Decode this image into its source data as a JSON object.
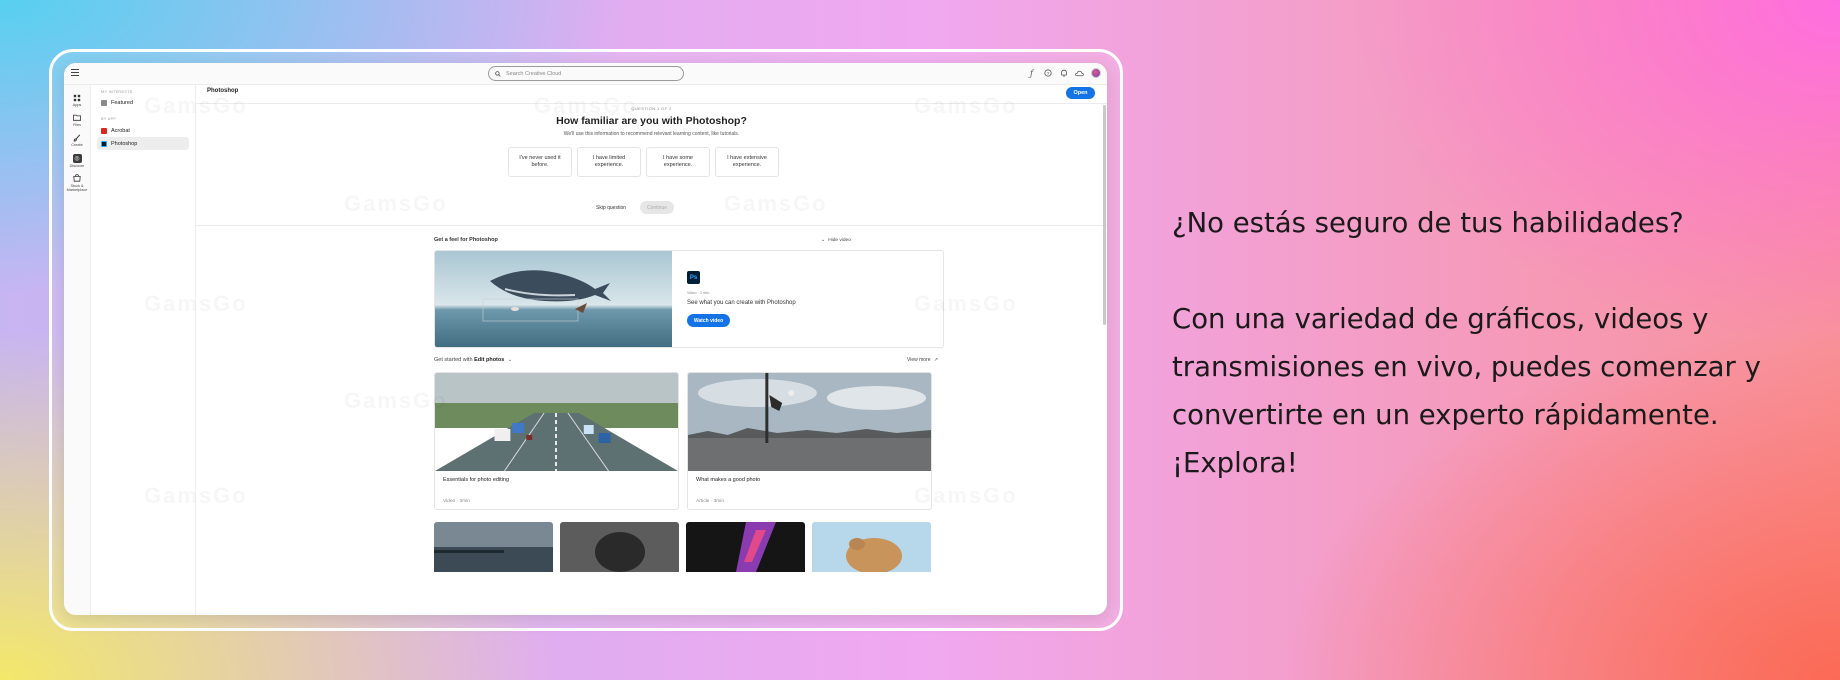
{
  "search": {
    "placeholder": "Search Creative Cloud"
  },
  "rail": [
    {
      "label": "Apps"
    },
    {
      "label": "Files"
    },
    {
      "label": "Create"
    },
    {
      "label": "Discover"
    },
    {
      "label": "Stock & Marketplace"
    }
  ],
  "panel": {
    "interests_heading": "MY INTERESTS",
    "featured": "Featured",
    "app_heading": "BY APP",
    "acrobat": "Acrobat",
    "photoshop": "Photoshop"
  },
  "main": {
    "title": "Photoshop",
    "open_label": "Open",
    "question_counter": "QUESTION 1 OF 2",
    "question_title": "How familiar are you with Photoshop?",
    "question_sub": "We'll use this information to recommend relevant learning content, like tutorials.",
    "options": [
      "I've never used it before.",
      "I have limited experience.",
      "I have some experience.",
      "I have extensive experience."
    ],
    "skip_label": "Skip question",
    "continue_label": "Continue",
    "feel_title": "Get a feel for Photoshop",
    "hide_video": "Hide video",
    "hero_meta": "Video · 2 min",
    "hero_text": "See what you can create with Photoshop",
    "watch_label": "Watch video",
    "started_prefix": "Get started with",
    "started_topic": "Edit photos",
    "view_more": "View more",
    "cards": [
      {
        "title": "Essentials for photo editing",
        "meta": "Video · 3min"
      },
      {
        "title": "What makes a good photo",
        "meta": "Article · 3min"
      }
    ]
  },
  "watermark_text": "GamsGo",
  "promo": {
    "line1": "¿No estás seguro de tus habilidades?",
    "line2": "Con una variedad de gráficos, videos y transmisiones en vivo, puedes comenzar y convertirte en un experto rápidamente. ¡Explora!"
  },
  "colors": {
    "accent": "#1473e6",
    "photoshop_dark": "#001e36",
    "photoshop_blue": "#31a8ff"
  }
}
